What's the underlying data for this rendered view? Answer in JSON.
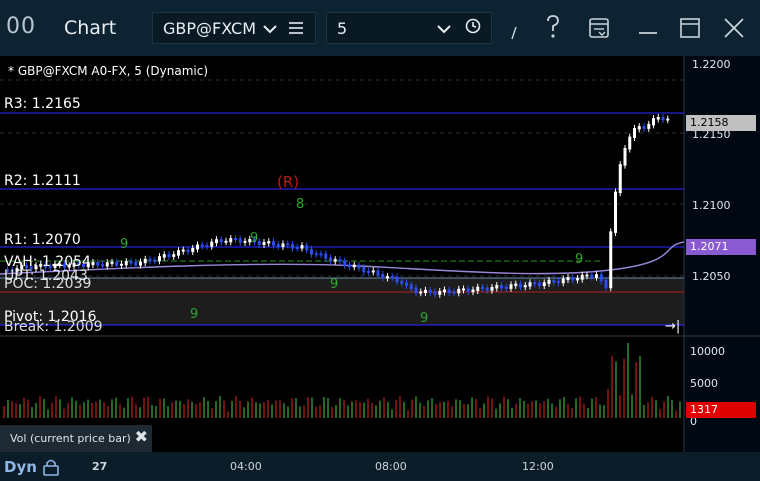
{
  "window": {
    "app_icon": "00",
    "title": "Chart",
    "symbol": "GBP@FXCM",
    "interval": "5",
    "icons": [
      "chevron-down-icon",
      "menu-icon",
      "clock-icon",
      "pencil-icon",
      "help-icon",
      "template-icon",
      "minimize-icon",
      "maximize-icon",
      "close-icon"
    ]
  },
  "chart": {
    "series_title": "* GBP@FXCM A0-FX, 5 (Dynamic)",
    "levels": {
      "r3": "R3: 1.2165",
      "r2": "R2: 1.2111",
      "r1": "R1: 1.2070",
      "vah": "VAH: 1.2054",
      "upt": "UPT: 1.2043",
      "poc": "POC: 1.2039",
      "pivot": "Pivot: 1.2016",
      "break": "Break: 1.2009"
    },
    "annotations": {
      "red_mark": "(R)",
      "green_counts": [
        "9",
        "8",
        "9",
        "9",
        "9",
        "9",
        "9"
      ]
    },
    "price_axis": [
      "1.2200",
      "1.2150",
      "1.2100",
      "1.2050"
    ],
    "price_tags": {
      "last": "1.2158",
      "r1": "1.2071"
    },
    "volume_axis": [
      "10000",
      "5000",
      "0"
    ],
    "volume_tag": "1317",
    "time_axis": [
      "27",
      "04:00",
      "08:00",
      "12:00"
    ],
    "volume_title": "Vol (current price bar)",
    "footer_label": "Dyn",
    "colors": {
      "background": "#000000",
      "level_line": "#2424d8",
      "up_candle": "#ffffff",
      "down_candle": "#2a4cf0",
      "volume_up": "#3fae3f",
      "volume_down": "#c02020",
      "last_tag": "#c0c0c0",
      "r1_tag": "#8a5bd0",
      "volume_tag": "#e00000"
    }
  }
}
